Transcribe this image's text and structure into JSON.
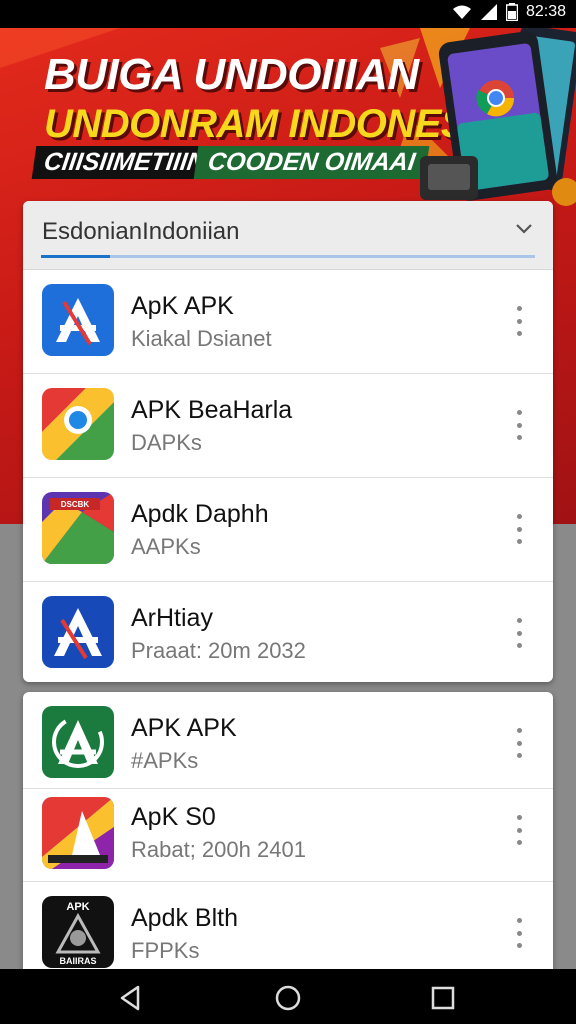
{
  "status_bar": {
    "time": "82:38",
    "icons": [
      "wifi-icon",
      "signal-icon",
      "battery-icon"
    ]
  },
  "banner": {
    "title_line1": "BUIGA UNDOIIIAN",
    "title_line2": "UNDONRAM INDONESIA",
    "tag_left": "CIIISIIMETIIIN",
    "tag_right": "COODEN OIMAAI"
  },
  "filter": {
    "label": "EsdonianIndoniian",
    "progress": 0.14
  },
  "apps_primary": [
    {
      "name": "ApK APK",
      "subtitle": "Kiakal Dsianet",
      "icon": "apk-store-blue-icon"
    },
    {
      "name": "APK BeaHarla",
      "subtitle": "DAPKs",
      "icon": "chrome-map-icon"
    },
    {
      "name": "Apdk Daphh",
      "subtitle": "AAPKs",
      "icon": "maps-flag-icon"
    },
    {
      "name": "ArHtiay",
      "subtitle": "Praaat: 20m 2032",
      "icon": "apk-store-darkblue-icon"
    }
  ],
  "apps_secondary": [
    {
      "name": "APK APK",
      "subtitle": "#APKs",
      "icon": "apk-green-icon"
    },
    {
      "name": "ApK S0",
      "subtitle": "Rabat; 200h 2401",
      "icon": "rainbow-a-icon"
    },
    {
      "name": "Apdk Blth",
      "subtitle": "FPPKs",
      "icon": "apk-black-emblem-icon"
    }
  ],
  "icon_texts": {
    "black_top": "APK",
    "black_bottom": "BAIIRAS",
    "maps_flag": "DSCBK"
  },
  "colors": {
    "banner_red": "#d8221a",
    "accent_blue": "#1a73c9",
    "title_yellow": "#f8d81c"
  },
  "nav": [
    "back-icon",
    "home-icon",
    "recents-icon"
  ]
}
